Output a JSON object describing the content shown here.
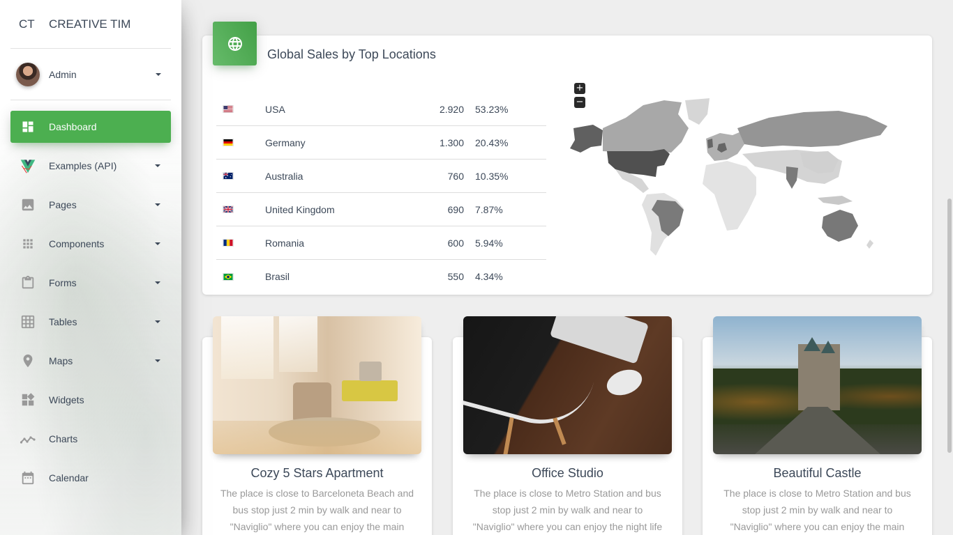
{
  "sidebar": {
    "logo_mini": "CT",
    "logo_normal": "CREATIVE TIM",
    "user_name": "Admin",
    "items": [
      {
        "label": "Dashboard",
        "icon": "dashboard-icon",
        "active": true
      },
      {
        "label": "Examples (API)",
        "icon": "vue-logo-icon",
        "caret": true
      },
      {
        "label": "Pages",
        "icon": "image-icon",
        "caret": true
      },
      {
        "label": "Components",
        "icon": "apps-grid-icon",
        "caret": true
      },
      {
        "label": "Forms",
        "icon": "clipboard-icon",
        "caret": true
      },
      {
        "label": "Tables",
        "icon": "grid-on-icon",
        "caret": true
      },
      {
        "label": "Maps",
        "icon": "place-icon",
        "caret": true
      },
      {
        "label": "Widgets",
        "icon": "widgets-icon"
      },
      {
        "label": "Charts",
        "icon": "timeline-icon"
      },
      {
        "label": "Calendar",
        "icon": "date-range-icon"
      }
    ]
  },
  "sales": {
    "title": "Global Sales by Top Locations",
    "icon": "language-icon",
    "zoom_in": "+",
    "zoom_out": "−",
    "rows": [
      {
        "country": "USA",
        "value": "2.920",
        "percent": "53.23%",
        "flag": "us"
      },
      {
        "country": "Germany",
        "value": "1.300",
        "percent": "20.43%",
        "flag": "de"
      },
      {
        "country": "Australia",
        "value": "760",
        "percent": "10.35%",
        "flag": "au"
      },
      {
        "country": "United Kingdom",
        "value": "690",
        "percent": "7.87%",
        "flag": "gb"
      },
      {
        "country": "Romania",
        "value": "600",
        "percent": "5.94%",
        "flag": "ro"
      },
      {
        "country": "Brasil",
        "value": "550",
        "percent": "4.34%",
        "flag": "br"
      }
    ]
  },
  "products": [
    {
      "title": "Cozy 5 Stars Apartment",
      "description": "The place is close to Barceloneta Beach and bus stop just 2 min by walk and near to \"Naviglio\" where you can enjoy the main night"
    },
    {
      "title": "Office Studio",
      "description": "The place is close to Metro Station and bus stop just 2 min by walk and near to \"Naviglio\" where you can enjoy the night life in London,"
    },
    {
      "title": "Beautiful Castle",
      "description": "The place is close to Metro Station and bus stop just 2 min by walk and near to \"Naviglio\" where you can enjoy the main night life in"
    }
  ]
}
